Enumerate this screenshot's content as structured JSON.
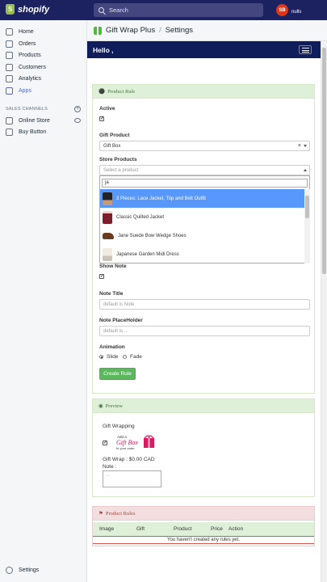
{
  "topbar": {
    "brand": "shopify",
    "search_placeholder": "Search",
    "avatar_initials": "SB",
    "user_name": "nulls"
  },
  "sidebar": {
    "items": [
      {
        "label": "Home",
        "icon": "home-icon"
      },
      {
        "label": "Orders",
        "icon": "orders-icon"
      },
      {
        "label": "Products",
        "icon": "products-icon"
      },
      {
        "label": "Customers",
        "icon": "customers-icon"
      },
      {
        "label": "Analytics",
        "icon": "analytics-icon"
      },
      {
        "label": "Apps",
        "icon": "apps-icon",
        "active": true
      }
    ],
    "sales_channels_label": "SALES CHANNELS",
    "channels": [
      {
        "label": "Online Store",
        "icon": "store-icon"
      },
      {
        "label": "Buy Button",
        "icon": "buy-button-icon"
      }
    ],
    "settings_label": "Settings"
  },
  "header": {
    "app_name": "Gift Wrap Plus",
    "separator": "/",
    "page": "Settings"
  },
  "app": {
    "hello": "Hello ,",
    "product_rule": {
      "title": "Product Rule",
      "active_label": "Active",
      "active_checked": true,
      "gift_product_label": "Gift Product",
      "gift_product_value": "Gift Box",
      "store_products_label": "Store Products",
      "store_products_placeholder": "Select a product",
      "dropdown_search_value": "ja",
      "dropdown_options": [
        "3 Pieces: Lace Jacket, Top and Belt Outfit",
        "Classic Quilted Jacket",
        "Jane Suede Bow Wedge Shoes",
        "Japanese Garden Midi Dress"
      ],
      "show_note_label": "Show Note",
      "show_note_checked": true,
      "note_title_label": "Note Title",
      "note_title_placeholder": "default is Note",
      "note_placeholder_label": "Note PlaceHolder",
      "note_placeholder_placeholder": "default is ...",
      "animation_label": "Animation",
      "animation_options": [
        "Slide",
        "Fade"
      ],
      "animation_selected": "Slide",
      "create_button": "Create Rule"
    },
    "preview": {
      "title": "Preview",
      "gift_wrapping_label": "Gift Wrapping",
      "gift_wrap_price": "Gift Wrap : $0.00 CAD",
      "note_label": "Note :",
      "note_textarea_placeholder": "..."
    },
    "product_rules": {
      "title": "Product Rules",
      "columns": [
        "Image",
        "Gift",
        "Product",
        "Price",
        "Action"
      ],
      "empty_message": "You haven't created any rules yet."
    }
  },
  "colors": {
    "topbar": "#1c2260",
    "app_navbar": "#0f1d5a",
    "panel_success": "#dff0d8",
    "panel_danger": "#f2dede",
    "button_green": "#5cb85c",
    "highlight": "#5897fb",
    "active_nav": "#5c6ac4"
  }
}
